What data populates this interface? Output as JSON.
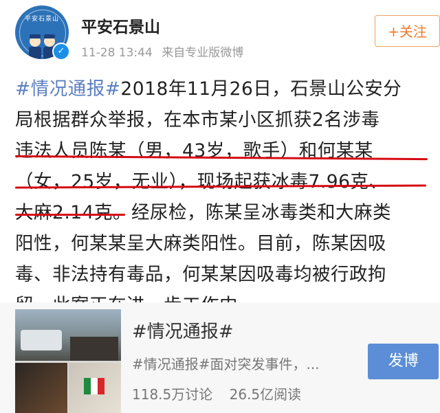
{
  "account": {
    "name": "平安石景山",
    "timestamp": "11-28 13:44",
    "source": "来自专业版微博",
    "avatar_text": "平安石景山",
    "verified_icon": "check",
    "follow_label": "+关注"
  },
  "post": {
    "lines": [
      {
        "tag": "#情况通报#",
        "text": "2018年11月26日，石景山公安分"
      },
      {
        "tag": "",
        "text": "局根据群众举报，在本市某小区抓获2名涉毒"
      },
      {
        "tag": "",
        "text": "违法人员陈某（男，43岁，歌手）和何某某"
      },
      {
        "tag": "",
        "text": "（女，25岁，无业），现场起获冰毒7.96克、"
      },
      {
        "tag": "",
        "text": "大麻2.14克。经尿检，陈某呈冰毒类和大麻类"
      },
      {
        "tag": "",
        "text": "阳性，何某某呈大麻类阳性。目前，陈某因吸"
      },
      {
        "tag": "",
        "text": "毒、非法持有毒品，何某某因吸毒均被行政拘"
      },
      {
        "tag": "",
        "text": "留。此案正在进一步工作中。"
      }
    ],
    "highlight_color": "#d60a12"
  },
  "topic_card": {
    "title": "#情况通报#",
    "subtitle": "#情况通报#面对突发事件，...",
    "discussions": "118.5万讨论",
    "reads": "26.5亿阅读",
    "post_button": "发博"
  },
  "colors": {
    "accent": "#f07b2c",
    "link": "#5b7fc0",
    "button": "#5b8ed6"
  }
}
